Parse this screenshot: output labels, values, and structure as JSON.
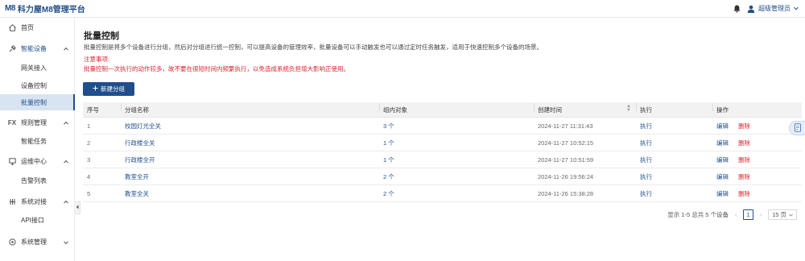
{
  "app": {
    "logo_mark": "M8",
    "title": "科力屋M8管理平台"
  },
  "header": {
    "user_label": "超级管理员"
  },
  "sidebar": {
    "items": [
      {
        "label": "首页",
        "icon": "home-icon"
      },
      {
        "label": "智能设备",
        "icon": "device-icon",
        "sub": [
          "网关接入",
          "设备控制",
          "批量控制"
        ]
      },
      {
        "label": "规则管理",
        "icon": "fx-icon",
        "icon_text": "FX",
        "sub": [
          "智能任务"
        ]
      },
      {
        "label": "运维中心",
        "icon": "monitor-icon",
        "sub": [
          "告警列表"
        ]
      },
      {
        "label": "系统对接",
        "icon": "network-icon",
        "sub": [
          "API接口"
        ]
      },
      {
        "label": "系统管理",
        "icon": "settings-icon"
      }
    ],
    "active_sub": "批量控制"
  },
  "main": {
    "title": "批量控制",
    "description": "批量控制是将多个设备进行分组，然后对分组进行统一控制，可以提高设备的管理效率，批量设备可以手动触发也可以通过定时任务触发，适用于快速控制多个设备的场景。",
    "notice_title": "注意事项:",
    "notice_body": "批量控制一次执行的动作较多，故不要在很短时间内频繁执行，以免造成系统负担增大影响正使用。",
    "new_button": "新建分组"
  },
  "table": {
    "headers": [
      "序号",
      "分组名称",
      "组内对象",
      "创建时间",
      "执行",
      "操作"
    ],
    "rows": [
      {
        "index": "1",
        "name": "校园灯光全关",
        "count": "3 个",
        "created": "2024-11-27 11:31:43",
        "exec": "执行",
        "edit": "编辑",
        "delete": "删除"
      },
      {
        "index": "2",
        "name": "行政楼全关",
        "count": "1 个",
        "created": "2024-11-27 10:52:15",
        "exec": "执行",
        "edit": "编辑",
        "delete": "删除"
      },
      {
        "index": "3",
        "name": "行政楼全开",
        "count": "1 个",
        "created": "2024-11-27 10:51:59",
        "exec": "执行",
        "edit": "编辑",
        "delete": "删除"
      },
      {
        "index": "4",
        "name": "教室全开",
        "count": "2 个",
        "created": "2024-11-26 19:56:24",
        "exec": "执行",
        "edit": "编辑",
        "delete": "删除"
      },
      {
        "index": "5",
        "name": "教室全关",
        "count": "2 个",
        "created": "2024-11-26 15:38:28",
        "exec": "执行",
        "edit": "编辑",
        "delete": "删除"
      }
    ]
  },
  "pagination": {
    "summary": "显示 1-5 总共 5 个设备",
    "current": "1",
    "page_size": "15 页"
  },
  "colors": {
    "brand": "#1f4e8c",
    "danger": "#d9232d",
    "active_bg": "#d9e4f2"
  }
}
